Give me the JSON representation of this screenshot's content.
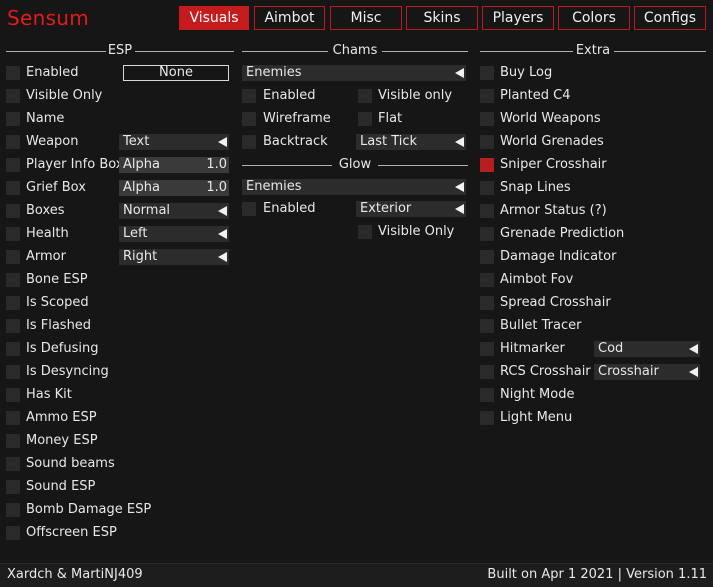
{
  "app": {
    "title": "Sensum"
  },
  "tabs": [
    {
      "label": "Visuals",
      "active": true
    },
    {
      "label": "Aimbot"
    },
    {
      "label": "Misc"
    },
    {
      "label": "Skins"
    },
    {
      "label": "Players"
    },
    {
      "label": "Colors"
    },
    {
      "label": "Configs"
    }
  ],
  "esp": {
    "header": "ESP",
    "enabled_label": "Enabled",
    "enabled_key": "None",
    "items": [
      "Enabled",
      "Visible Only",
      "Name",
      "Weapon",
      "Player Info Box",
      "Grief Box",
      "Boxes",
      "Health",
      "Armor",
      "Bone ESP",
      "Is Scoped",
      "Is Flashed",
      "Is Defusing",
      "Is Desyncing",
      "Has Kit",
      "Ammo ESP",
      "Money ESP",
      "Sound beams",
      "Sound ESP",
      "Bomb Damage ESP",
      "Offscreen ESP"
    ],
    "weapon_mode": "Text",
    "player_info_slider": {
      "label": "Alpha",
      "value": "1.0"
    },
    "grief_slider": {
      "label": "Alpha",
      "value": "1.0"
    },
    "boxes_mode": "Normal",
    "health_mode": "Left",
    "armor_mode": "Right"
  },
  "chams": {
    "header": "Chams",
    "target": "Enemies",
    "enabled": "Enabled",
    "visible_only": "Visible only",
    "wireframe": "Wireframe",
    "flat": "Flat",
    "backtrack": "Backtrack",
    "backtrack_mode": "Last Tick"
  },
  "glow": {
    "header": "Glow",
    "target": "Enemies",
    "enabled": "Enabled",
    "style": "Exterior",
    "visible_only": "Visible Only"
  },
  "extra": {
    "header": "Extra",
    "items": [
      {
        "label": "Buy Log",
        "checked": false
      },
      {
        "label": "Planted C4",
        "checked": false
      },
      {
        "label": "World Weapons",
        "checked": false
      },
      {
        "label": "World Grenades",
        "checked": false
      },
      {
        "label": "Sniper Crosshair",
        "checked": true
      },
      {
        "label": "Snap Lines",
        "checked": false
      },
      {
        "label": "Armor Status (?)",
        "checked": false
      },
      {
        "label": "Grenade Prediction",
        "checked": false
      },
      {
        "label": "Damage Indicator",
        "checked": false
      },
      {
        "label": "Aimbot Fov",
        "checked": false
      },
      {
        "label": "Spread Crosshair",
        "checked": false
      },
      {
        "label": "Bullet Tracer",
        "checked": false
      },
      {
        "label": "Hitmarker",
        "checked": false
      },
      {
        "label": "RCS Crosshair",
        "checked": false
      },
      {
        "label": "Night Mode",
        "checked": false
      },
      {
        "label": "Light Menu",
        "checked": false
      }
    ],
    "hitmarker_mode": "Cod",
    "rcs_mode": "Crosshair"
  },
  "footer": {
    "authors": "Xardch & MartiNJ409",
    "build": "Built on Apr  1 2021 | Version 1.11"
  },
  "colors": {
    "accent": "#c41c1c",
    "checked": "#b51f1f",
    "background": "#161616"
  }
}
